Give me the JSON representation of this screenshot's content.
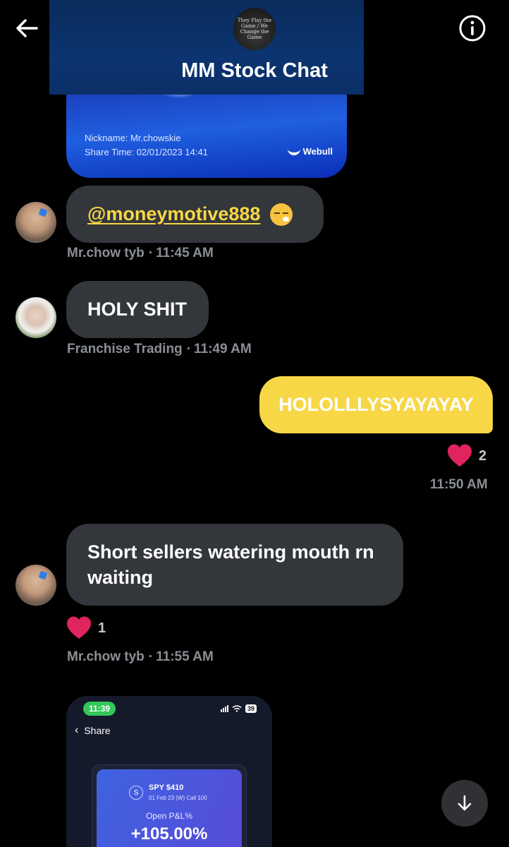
{
  "header": {
    "title": "MM Stock Chat",
    "group_avatar_text": "They Play the Game / We Change the Game",
    "back_icon": "arrow-left-icon",
    "info_icon": "info-icon"
  },
  "top_share_card": {
    "nickname": "Nickname: Mr.chowskie",
    "share_time": "Share Time: 02/01/2023 14:41",
    "brand": "Webull"
  },
  "messages": [
    {
      "sender": "Mr.chow tyb",
      "text": "@moneymotive888",
      "emoji": "face-exhaling-emoji",
      "time": "11:45 AM"
    },
    {
      "sender": "Franchise Trading",
      "text": "HOLY SHIT",
      "time": "11:49 AM"
    },
    {
      "sender": "me",
      "text": "HOLOLLLYSYAYAYAY",
      "time": "11:50 AM",
      "reaction_count": "2"
    },
    {
      "sender": "Mr.chow tyb",
      "text": "Short sellers watering mouth rn waiting",
      "time": "11:55 AM",
      "reaction_count": "1"
    }
  ],
  "phone_screenshot": {
    "time": "11:39",
    "battery": "39",
    "nav_label": "Share",
    "ticker_badge": "S",
    "ticker": "SPY $410",
    "contract": "01 Feb 23 (W) Call 100",
    "pnl_label": "Open P&L%",
    "pnl_value": "+105.00%"
  },
  "colors": {
    "accent_yellow": "#f7d746",
    "bubble_gray": "#33363b",
    "heart_red": "#e0245e",
    "meta_gray": "#8b8f95"
  }
}
